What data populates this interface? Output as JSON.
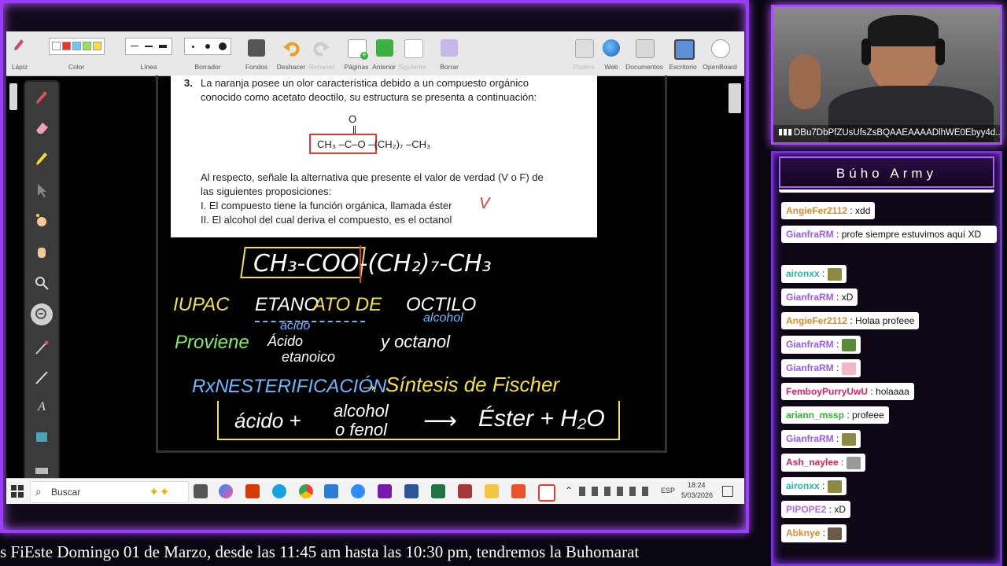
{
  "toolbar": {
    "groups": [
      {
        "label": "Lápiz"
      },
      {
        "label": "Color"
      },
      {
        "label": "Línea"
      },
      {
        "label": "Borrador"
      },
      {
        "label": "Fondos"
      },
      {
        "label": "Deshacer"
      },
      {
        "label": "Rehacer"
      },
      {
        "label": "Páginas"
      },
      {
        "label": "Anterior"
      },
      {
        "label": "Siguiente"
      },
      {
        "label": "Borrar"
      },
      {
        "label": "Pizarra"
      },
      {
        "label": "Web"
      },
      {
        "label": "Documentos"
      },
      {
        "label": "Escritorio"
      },
      {
        "label": "OpenBoard"
      }
    ],
    "colors": [
      "#ffffff",
      "#e53935",
      "#66ccff",
      "#9be05a",
      "#f5e23a"
    ]
  },
  "document": {
    "number": "3.",
    "line1": "La naranja posee un olor característica debido a un compuesto orgánico",
    "line2": "conocido como acetato deoctilo, su estructura se presenta a continuación:",
    "formula_o": "O",
    "formula": "CH₃ –C–O –(CH₂)₇ –CH₃",
    "line3": "Al respecto, señale la alternativa que presente el valor de verdad (V o F) de",
    "line4": "las siguientes proposiciones:",
    "prop1": "I.   El compuesto tiene la función orgánica, llamada éster",
    "prop1_mark": "V",
    "prop2": "II.  El alcohol del cual deriva el compuesto, es el octanol"
  },
  "board": {
    "formula": "CH₃-COO-(CH₂)₇-CH₃",
    "iupac": "IUPAC",
    "iupac_name_a": "ETANO",
    "iupac_name_b": "ATO DE",
    "iupac_name_c": "OCTILO",
    "acido_note": "ácido",
    "alcohol_note": "alcohol",
    "proviene": "Proviene",
    "acido": "Ácido",
    "etanoico": "etanoico",
    "y_octanol": "y octanol",
    "rxn_prefix": "RxN",
    "esterificacion": "ESTERIFICACIÓN",
    "arrow": "→",
    "sintesis": "Síntesis de Fischer",
    "eq_acido": "ácido +",
    "eq_alcohol": "alcohol",
    "eq_fenol": "o fenol",
    "eq_arrow": "⟶",
    "eq_ester": "Éster + H₂O"
  },
  "taskbar": {
    "search_placeholder": "Buscar",
    "language": "ESP",
    "time": "18:24",
    "date": "5/03/2026"
  },
  "ticker": {
    "text": "s FiEste Domingo 01 de Marzo, desde las 11:45 am hasta las 10:30 pm, tendremos la Buhomarat"
  },
  "webcam": {
    "stream_key": "DBu7DbPfZUsUfsZsBQAAEAAAADlhWE0Ebyy4d..."
  },
  "chat": {
    "title": "Búho Army",
    "messages": [
      {
        "user": "AngieFer2112",
        "color": "#e08a2c",
        "text": ": xdd"
      },
      {
        "user": "GianfraRM",
        "color": "#9b59ff",
        "text": ": profe siempre estuvimos aquí XD"
      },
      {
        "user": "aironxx",
        "color": "#2ab7a9",
        "text": ":"
      },
      {
        "user": "GianfraRM",
        "color": "#9b59ff",
        "text": ": xD"
      },
      {
        "user": "AngieFer2112",
        "color": "#e08a2c",
        "text": ": Holaa profeee"
      },
      {
        "user": "GianfraRM",
        "color": "#9b59ff",
        "text": ":"
      },
      {
        "user": "GianfraRM",
        "color": "#9b59ff",
        "text": ":"
      },
      {
        "user": "FemboyPurryUwU",
        "color": "#e0245e",
        "text": ": holaaaa"
      },
      {
        "user": "ariann_mssp",
        "color": "#2fb62f",
        "text": ": profeee"
      },
      {
        "user": "GianfraRM",
        "color": "#9b59ff",
        "text": ":"
      },
      {
        "user": "Ash_naylee",
        "color": "#e0245e",
        "text": ":"
      },
      {
        "user": "aironxx",
        "color": "#2ab7a9",
        "text": ":"
      },
      {
        "user": "PIPOPE2",
        "color": "#b06cf0",
        "text": ": xD"
      },
      {
        "user": "Abknye",
        "color": "#e08a2c",
        "text": ":"
      }
    ]
  }
}
